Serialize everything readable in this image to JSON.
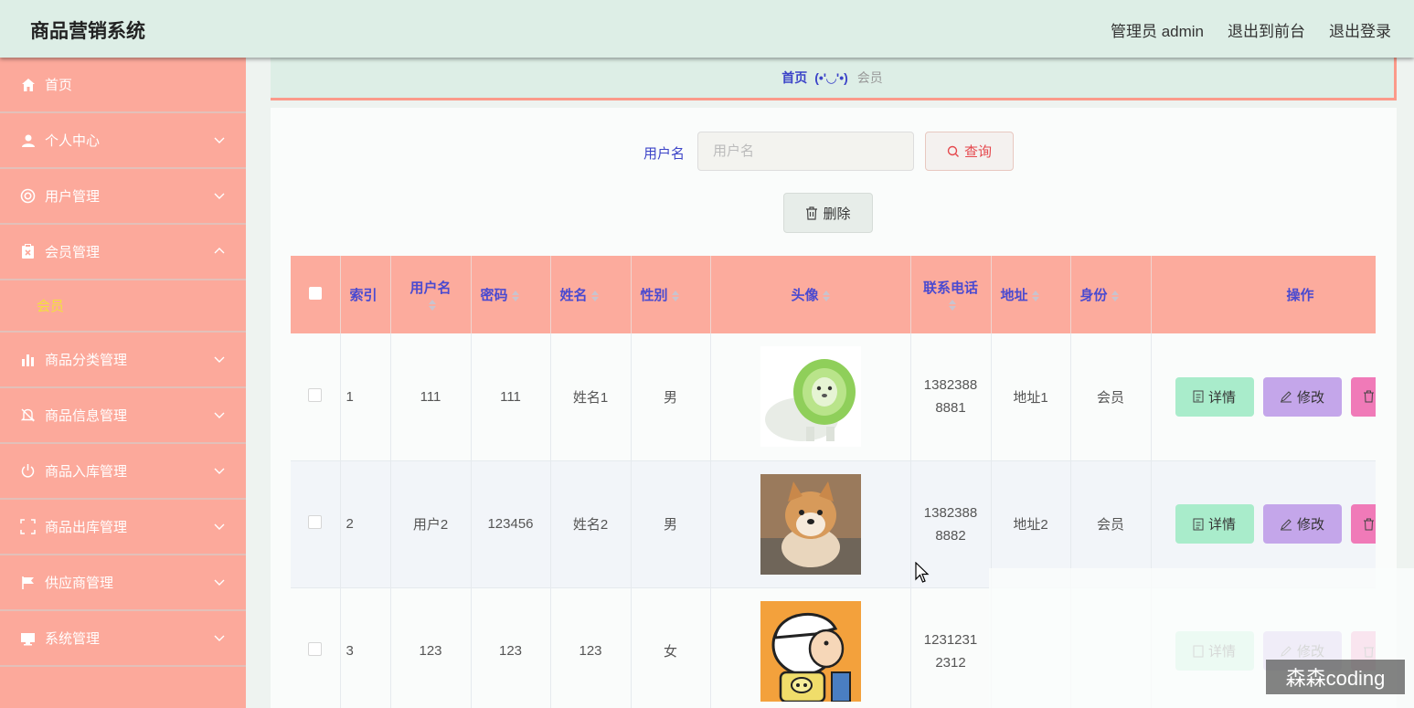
{
  "app": {
    "title": "商品营销系统"
  },
  "topnav": {
    "admin": "管理员 admin",
    "front": "退出到前台",
    "logout": "退出登录"
  },
  "sidebar": {
    "items": [
      {
        "label": "首页",
        "icon": "home-icon"
      },
      {
        "label": "个人中心",
        "icon": "user-icon"
      },
      {
        "label": "用户管理",
        "icon": "lifebuoy-icon"
      },
      {
        "label": "会员管理",
        "icon": "clipboard-icon",
        "expanded": true,
        "children": [
          {
            "label": "会员",
            "active": true
          }
        ]
      },
      {
        "label": "商品分类管理",
        "icon": "bar-chart-icon"
      },
      {
        "label": "商品信息管理",
        "icon": "bell-off-icon"
      },
      {
        "label": "商品入库管理",
        "icon": "power-icon"
      },
      {
        "label": "商品出库管理",
        "icon": "fullscreen-icon"
      },
      {
        "label": "供应商管理",
        "icon": "flag-icon"
      },
      {
        "label": "系统管理",
        "icon": "monitor-icon"
      }
    ]
  },
  "breadcrumb": {
    "home": "首页",
    "face": "(•'◡'•)",
    "current": "会员"
  },
  "search": {
    "label": "用户名",
    "placeholder": "用户名",
    "value": "",
    "button": "查询"
  },
  "toolbar": {
    "delete": "删除"
  },
  "table": {
    "headers": [
      "索引",
      "用户名",
      "密码",
      "姓名",
      "性别",
      "头像",
      "联系电话",
      "地址",
      "身份",
      "操作"
    ],
    "rows": [
      {
        "index": "1",
        "username": "111",
        "password": "111",
        "name": "姓名1",
        "gender": "男",
        "avatar": "cabbage-dog-avatar",
        "phone": "13823888881",
        "address": "地址1",
        "role": "会员"
      },
      {
        "index": "2",
        "username": "用户2",
        "password": "123456",
        "name": "姓名2",
        "gender": "男",
        "avatar": "shiba-dog-avatar",
        "phone": "13823888882",
        "address": "地址2",
        "role": "会员"
      },
      {
        "index": "3",
        "username": "123",
        "password": "123",
        "name": "123",
        "gender": "女",
        "avatar": "cartoon-boy-avatar",
        "phone": "12312312312",
        "address": "",
        "role": ""
      }
    ],
    "actions": {
      "detail": "详情",
      "edit": "修改"
    }
  },
  "watermark": "森森coding",
  "colors": {
    "topbar": "#ddeee6",
    "sidebar": "#fca99b",
    "header": "#fcab9d",
    "headerText": "#4a4ad0",
    "detailBtn": "#a9eccb",
    "editBtn": "#c4a6ea",
    "deleteBtn": "#f07ab8",
    "activeSub": "#f3e03c"
  }
}
